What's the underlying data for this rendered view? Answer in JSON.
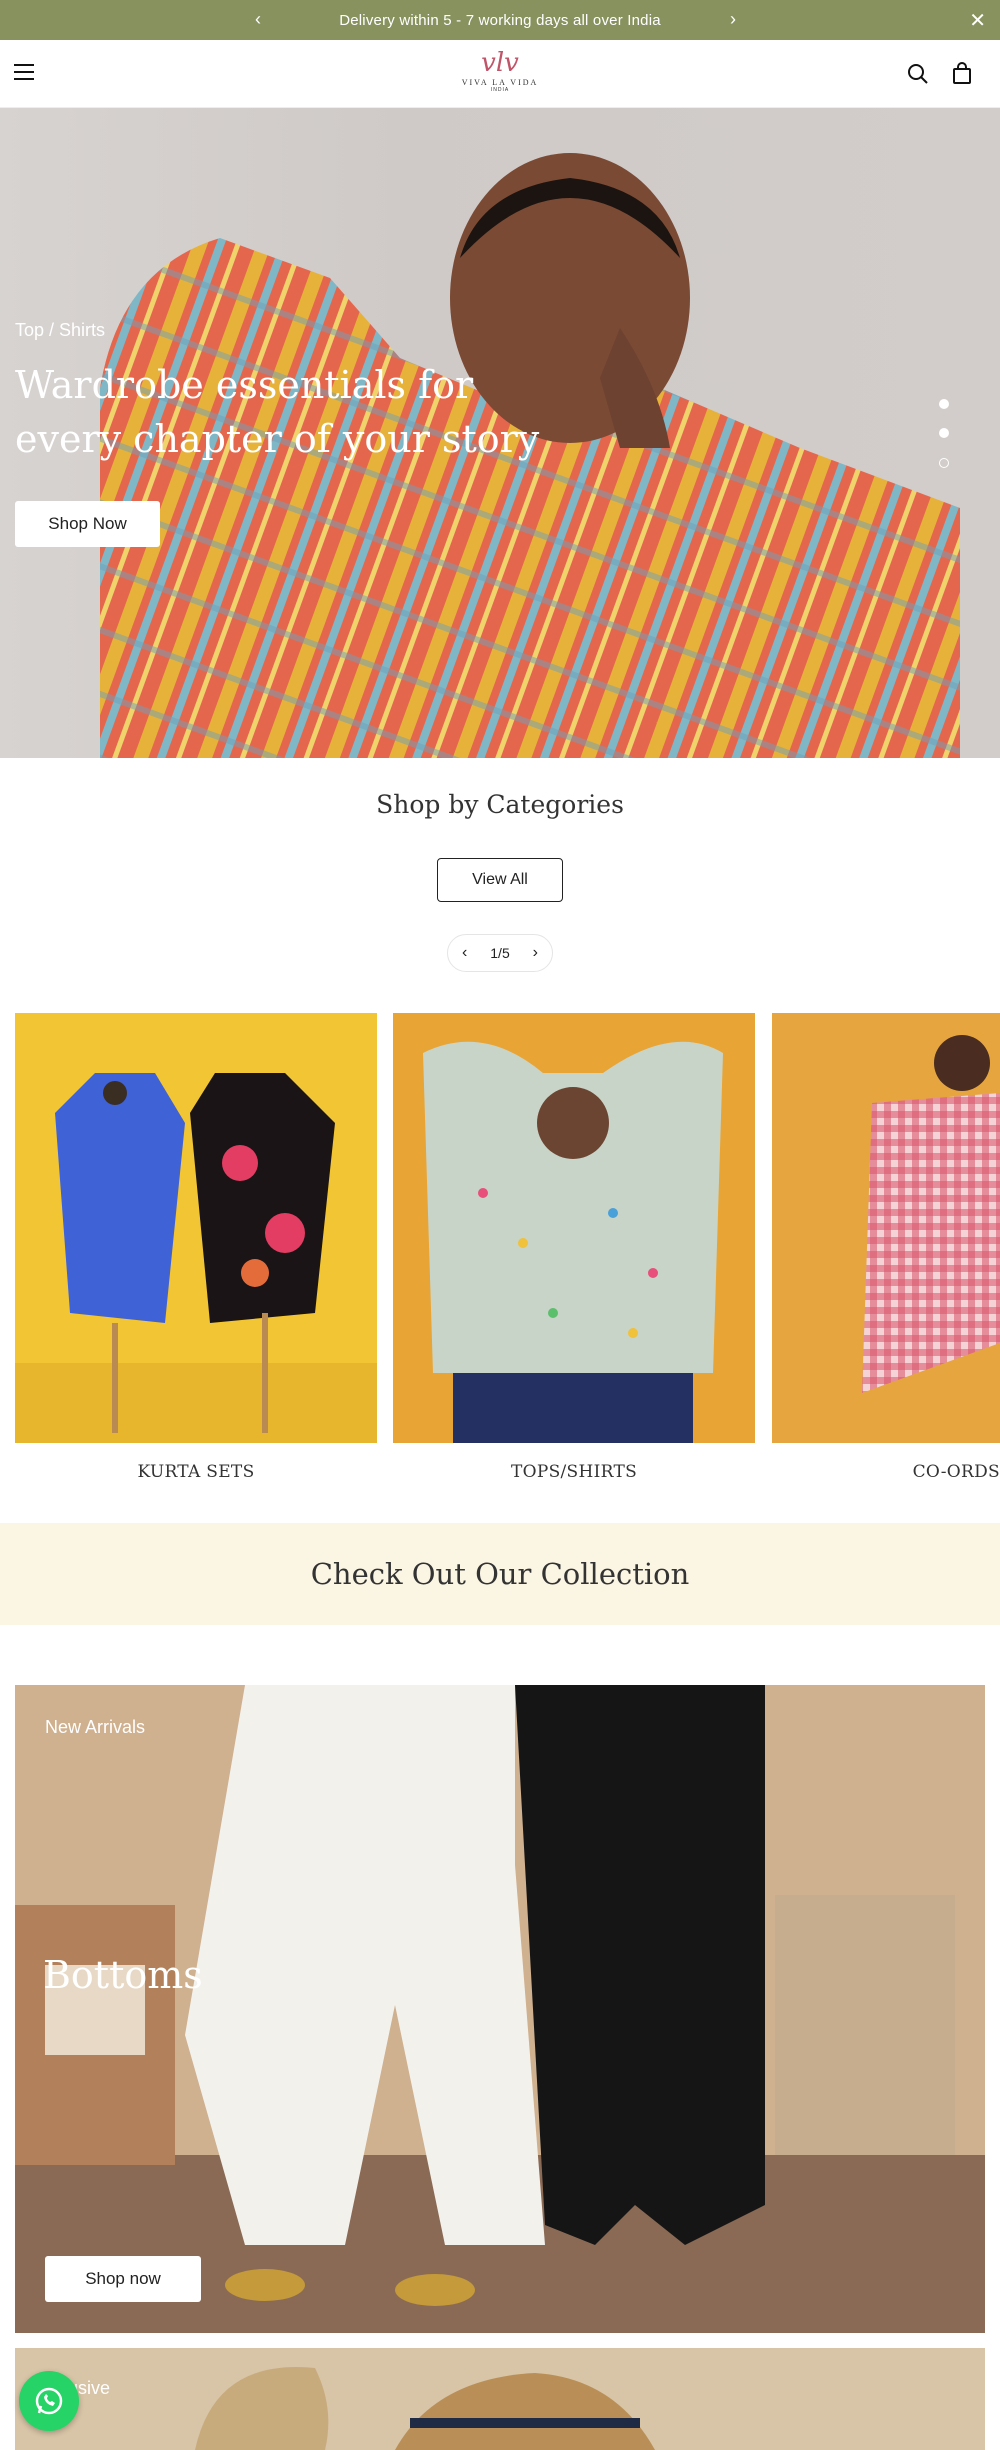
{
  "announcement": {
    "text": "Delivery within 5 - 7 working days all over India",
    "bg_color": "#87925f"
  },
  "header": {
    "logo_mark": "vlv",
    "logo_name": "VIVA LA VIDA",
    "logo_sub": "INDIA",
    "icons": [
      "menu-icon",
      "search-icon",
      "bag-icon"
    ]
  },
  "hero": {
    "breadcrumb": "Top / Shirts",
    "title": "Wardrobe essentials for every chapter of your story",
    "cta": "Shop Now",
    "slide_count": 3,
    "active_slide": 3
  },
  "categories": {
    "title": "Shop by Categories",
    "view_all": "View All",
    "pager": "1/5",
    "items": [
      {
        "label": "KURTA SETS"
      },
      {
        "label": "TOPS/SHIRTS"
      },
      {
        "label": "CO-ORDS"
      }
    ]
  },
  "collection": {
    "title": "Check Out Our Collection",
    "bg_color": "#fbf5e3"
  },
  "promo": {
    "tag": "New Arrivals",
    "title": "Bottoms",
    "cta": "Shop now"
  },
  "promo2": {
    "tag": "usive"
  },
  "whatsapp": {
    "color": "#25d366"
  }
}
